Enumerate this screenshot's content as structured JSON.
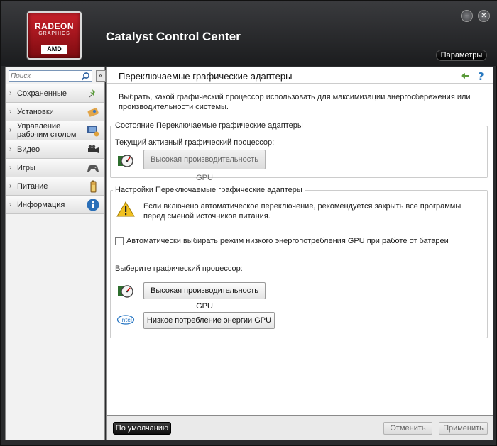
{
  "window": {
    "title": "Catalyst Control Center",
    "params_label": "Параметры",
    "minimize_glyph": "–",
    "close_glyph": "✕"
  },
  "logo": {
    "line1": "RADEON",
    "line2": "GRAPHICS",
    "line3": "AMD"
  },
  "sidebar": {
    "search_placeholder": "Поиск",
    "collapse_glyph": "«",
    "items": [
      {
        "label": "Сохраненные",
        "icon": "pin-icon"
      },
      {
        "label": "Установки",
        "icon": "presets-icon"
      },
      {
        "label": "Управление\nрабочим столом",
        "icon": "desktop-icon"
      },
      {
        "label": "Видео",
        "icon": "video-camera-icon"
      },
      {
        "label": "Игры",
        "icon": "gamepad-icon"
      },
      {
        "label": "Питание",
        "icon": "battery-icon"
      },
      {
        "label": "Информация",
        "icon": "info-icon"
      }
    ]
  },
  "page": {
    "title": "Переключаемые графические адаптеры",
    "description": "Выбрать, какой графический процессор использовать для максимизации энергосбережения или производительности системы.",
    "status_group": {
      "legend": "Состояние Переключаемые графические адаптеры",
      "current_label": "Текущий активный графический процессор:",
      "current_value": "Высокая производительность GPU"
    },
    "settings_group": {
      "legend": "Настройки Переключаемые графические адаптеры",
      "warning": "Если включено автоматическое переключение, рекомендуется закрыть все программы перед сменой источников питания.",
      "auto_checkbox_label": "Автоматически выбирать режим низкого энергопотребления GPU при работе от батареи",
      "auto_checked": false,
      "choose_label": "Выберите графический процессор:",
      "high_perf_button": "Высокая производительность GPU",
      "low_power_button": "Низкое потребление энергии GPU",
      "intel_logo_text": "intel"
    }
  },
  "footer": {
    "default_label": "По умолчанию",
    "cancel_label": "Отменить",
    "apply_label": "Применить"
  },
  "colors": {
    "accent_red": "#c8202a",
    "header_dark": "#1b1c1e",
    "help_blue": "#2a7ac0"
  }
}
